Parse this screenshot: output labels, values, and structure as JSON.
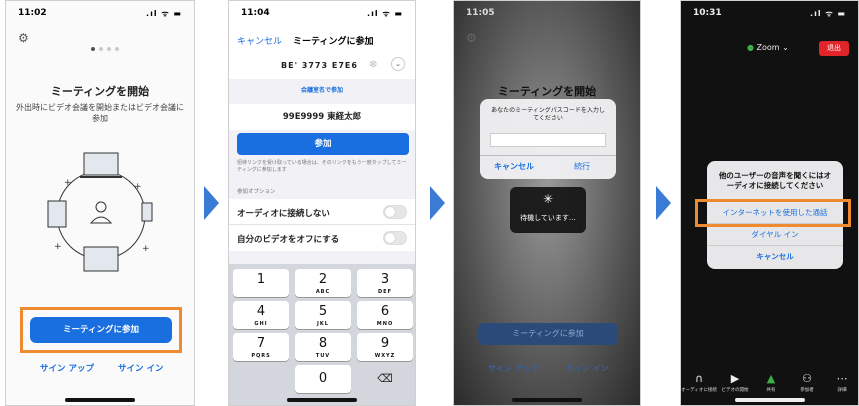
{
  "phone1": {
    "time": "11:02",
    "signal": ".ıl ᯤ ▬",
    "title": "ミーティングを開始",
    "subtitle": "外出時にビデオ会議を開始またはビデオ会議に参加",
    "join_button": "ミーティングに参加",
    "signup": "サイン アップ",
    "signin": "サイン イン",
    "gear_icon": "gear-icon"
  },
  "phone2": {
    "time": "11:04",
    "signal": ".ıl ᯤ ▬",
    "cancel": "キャンセル",
    "title": "ミーティングに参加",
    "meeting_id": "BE' 3773 E7E6",
    "join_with_name": "会議室名で参加",
    "name_value": "99E9999 東経太郎",
    "join_button": "参加",
    "hint": "招待リンクを受け取っている場合は、そのリンクをもう一度タップしてミーティングに参加します",
    "options_header": "参加オプション",
    "option_audio": "オーディオに接続しない",
    "option_video": "自分のビデオをオフにする",
    "keys": [
      {
        "n": "1",
        "l": ""
      },
      {
        "n": "2",
        "l": "ABC"
      },
      {
        "n": "3",
        "l": "DEF"
      },
      {
        "n": "4",
        "l": "GHI"
      },
      {
        "n": "5",
        "l": "JKL"
      },
      {
        "n": "6",
        "l": "MNO"
      },
      {
        "n": "7",
        "l": "PQRS"
      },
      {
        "n": "8",
        "l": "TUV"
      },
      {
        "n": "9",
        "l": "WXYZ"
      },
      {
        "n": "0",
        "l": ""
      },
      {
        "n": "⌫",
        "l": ""
      }
    ]
  },
  "phone3": {
    "time": "11:05",
    "bg_title": "ミーティングを開始",
    "passcode_prompt": "あなたのミーティングパスコードを入力してください",
    "cancel": "キャンセル",
    "continue": "続行",
    "waiting": "待機しています…",
    "join_button": "ミーティングに参加",
    "signup": "サイン アップ",
    "signin": "サイン イン"
  },
  "phone4": {
    "time": "10:31",
    "signal": ".ıl ᯤ ▬",
    "zoom_label": "Zoom",
    "leave": "退出",
    "dialog_title": "他のユーザーの音声を聞くにはオーディオに接続してください",
    "internet_audio": "インターネットを使用した通話",
    "dial_in": "ダイヤル イン",
    "cancel": "キャンセル",
    "toolbar": [
      {
        "icon": "headphones-icon",
        "glyph": "🎧",
        "label": "オーディオに接続"
      },
      {
        "icon": "video-off-icon",
        "glyph": "▶",
        "label": "ビデオの開始"
      },
      {
        "icon": "share-icon",
        "glyph": "⬆",
        "label": "共有"
      },
      {
        "icon": "participants-icon",
        "glyph": "👥",
        "label": "参加者"
      },
      {
        "icon": "more-icon",
        "glyph": "⋯",
        "label": "詳細"
      }
    ]
  },
  "colors": {
    "accent": "#1a6fe0",
    "highlight": "#f08a30",
    "leave_red": "#e0262a",
    "arrow": "#3a7bd5"
  }
}
